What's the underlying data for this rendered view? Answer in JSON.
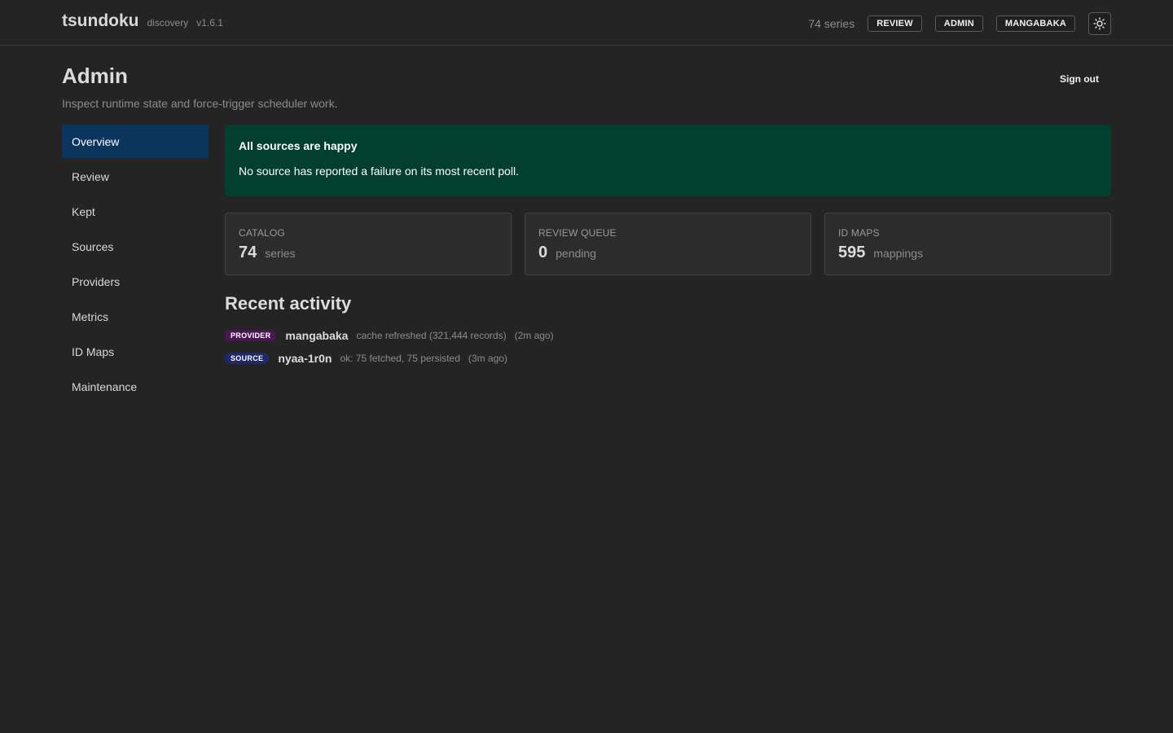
{
  "header": {
    "brand": "tsundoku",
    "subtitle": "discovery",
    "version": "v1.6.1",
    "series_count": "74 series",
    "nav": [
      "REVIEW",
      "ADMIN",
      "MANGABAKA"
    ],
    "theme_icon": "sun-icon"
  },
  "page": {
    "title": "Admin",
    "subtitle": "Inspect runtime state and force-trigger scheduler work.",
    "sign_out": "Sign out"
  },
  "sidebar": {
    "items": [
      {
        "label": "Overview",
        "active": true
      },
      {
        "label": "Review"
      },
      {
        "label": "Kept"
      },
      {
        "label": "Sources"
      },
      {
        "label": "Providers"
      },
      {
        "label": "Metrics"
      },
      {
        "label": "ID Maps"
      },
      {
        "label": "Maintenance"
      }
    ]
  },
  "banner": {
    "title": "All sources are happy",
    "message": "No source has reported a failure on its most recent poll.",
    "color": "#033f2f"
  },
  "stats": [
    {
      "label": "CATALOG",
      "value": "74",
      "unit": "series"
    },
    {
      "label": "REVIEW QUEUE",
      "value": "0",
      "unit": "pending"
    },
    {
      "label": "ID MAPS",
      "value": "595",
      "unit": "mappings"
    }
  ],
  "activity": {
    "title": "Recent activity",
    "items": [
      {
        "badge": "PROVIDER",
        "name": "mangabaka",
        "detail": "cache refreshed (321,444 records)",
        "time": "(2m ago)"
      },
      {
        "badge": "SOURCE",
        "name": "nyaa-1r0n",
        "detail": "ok: 75 fetched, 75 persisted",
        "time": "(3m ago)"
      }
    ]
  }
}
